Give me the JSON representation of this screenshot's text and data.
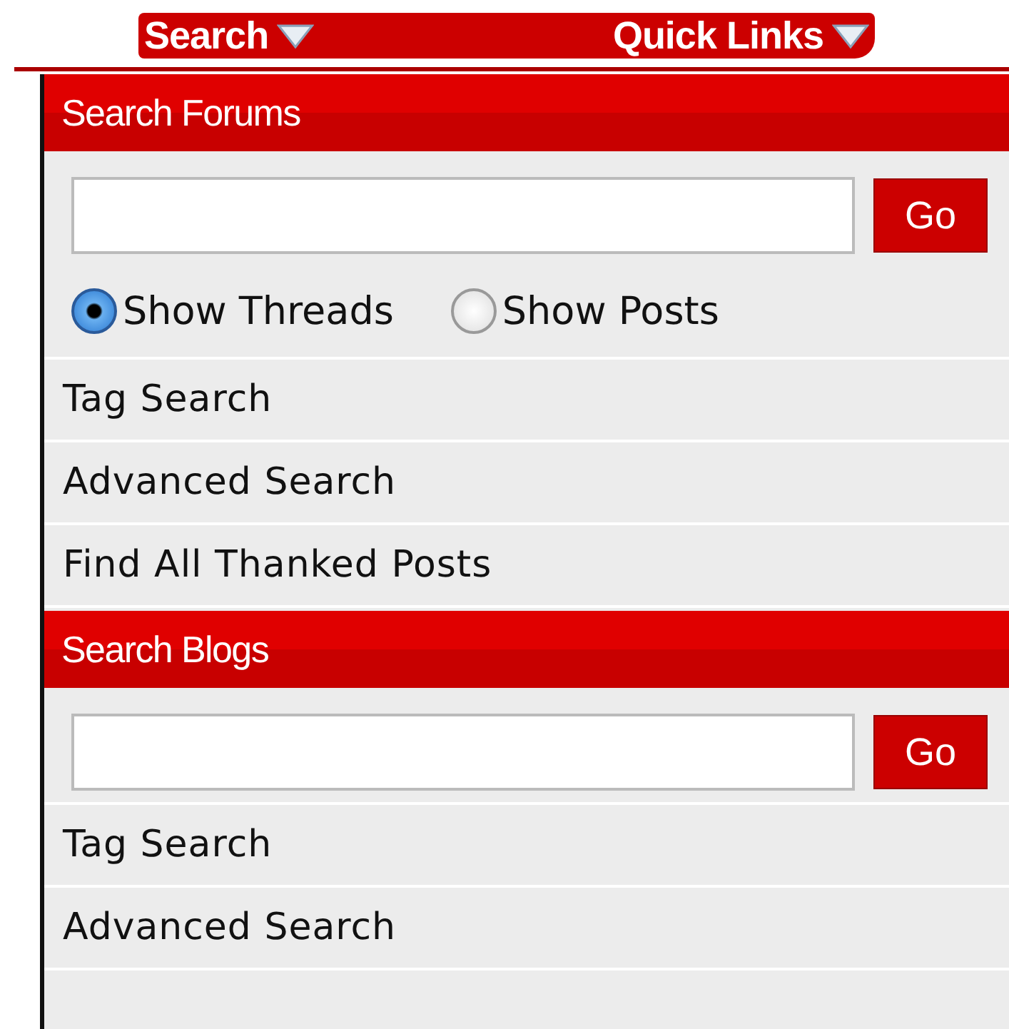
{
  "nav": [
    {
      "label": "Search"
    },
    {
      "label": "Quick Links"
    }
  ],
  "sections": [
    {
      "title": "Search Forums",
      "button": "Go",
      "radios": [
        {
          "label": "Show Threads",
          "selected": true
        },
        {
          "label": "Show Posts",
          "selected": false
        }
      ],
      "links": [
        "Tag Search",
        "Advanced Search",
        "Find All Thanked Posts"
      ]
    },
    {
      "title": "Search Blogs",
      "button": "Go",
      "links": [
        "Tag Search",
        "Advanced Search"
      ]
    }
  ]
}
